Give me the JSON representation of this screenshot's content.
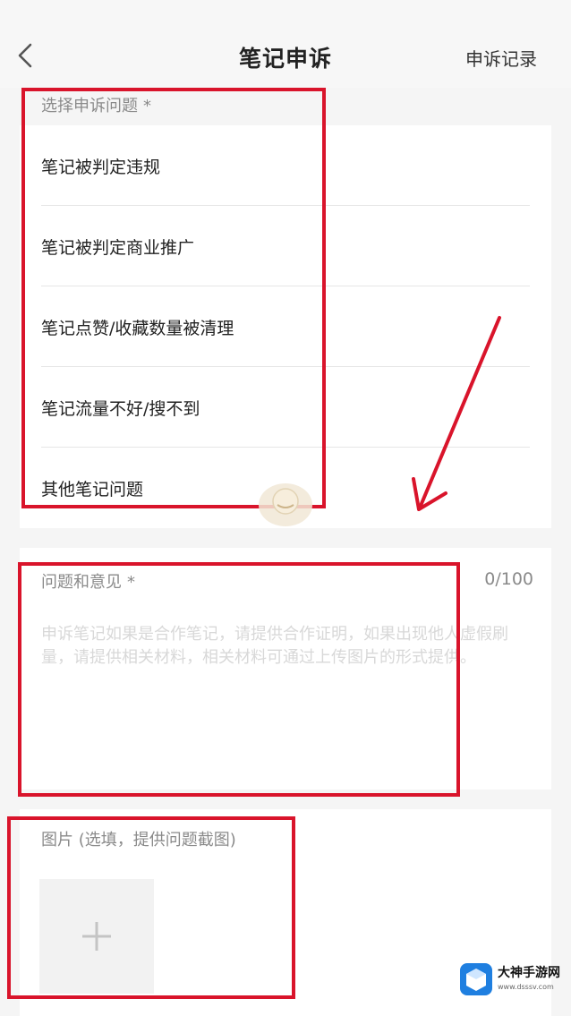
{
  "header": {
    "title": "笔记申诉",
    "records_label": "申诉记录"
  },
  "issue_section": {
    "label": "选择申诉问题",
    "required_mark": "*",
    "items": [
      {
        "label": "笔记被判定违规"
      },
      {
        "label": "笔记被判定商业推广"
      },
      {
        "label": "笔记点赞/收藏数量被清理"
      },
      {
        "label": "笔记流量不好/搜不到"
      },
      {
        "label": "其他笔记问题"
      }
    ]
  },
  "feedback_section": {
    "label": "问题和意见",
    "required_mark": "*",
    "counter": "0/100",
    "value": "",
    "placeholder": "申诉笔记如果是合作笔记，请提供合作证明，如果出现他人虚假刷量，请提供相关材料，相关材料可通过上传图片的形式提供。"
  },
  "image_section": {
    "label": "图片 (选填，提供问题截图)"
  },
  "watermark": {
    "site_name": "大神手游网",
    "site_url": "www.dsssv.com"
  },
  "colors": {
    "annotation_red": "#d9142b",
    "background": "#f5f5f5",
    "card": "#ffffff"
  },
  "icons": [
    "back-chevron-icon",
    "plus-icon",
    "site-logo-icon",
    "watermark-icon",
    "arrow-annotation"
  ]
}
